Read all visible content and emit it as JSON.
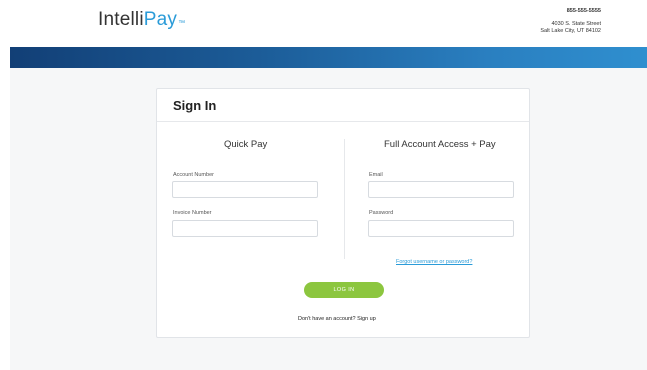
{
  "header": {
    "logo": {
      "part1": "Intelli",
      "part2": "Pay",
      "tm": "™"
    },
    "contact": {
      "phone": "855-555-5555",
      "address_line1": "4030 S. State Street",
      "address_line2": "Salt Lake City, UT 84102"
    }
  },
  "signin": {
    "title": "Sign In",
    "quick_pay": {
      "title": "Quick Pay",
      "account_number": {
        "label": "Account Number",
        "value": "",
        "placeholder": ""
      },
      "invoice_number": {
        "label": "Invoice Number",
        "value": "",
        "placeholder": ""
      }
    },
    "full_access": {
      "title": "Full Account Access + Pay",
      "email": {
        "label": "Email",
        "value": "",
        "placeholder": ""
      },
      "password": {
        "label": "Password",
        "value": "",
        "placeholder": ""
      },
      "forgot_link": "Forgot username or password?"
    },
    "login_button": "LOG IN",
    "signup_text": "Don't have an account? Sign up"
  },
  "colors": {
    "brand_blue": "#2a9bd8",
    "band_dark": "#123f76",
    "band_light": "#2f8fcf",
    "login_green": "#8cc63f"
  }
}
